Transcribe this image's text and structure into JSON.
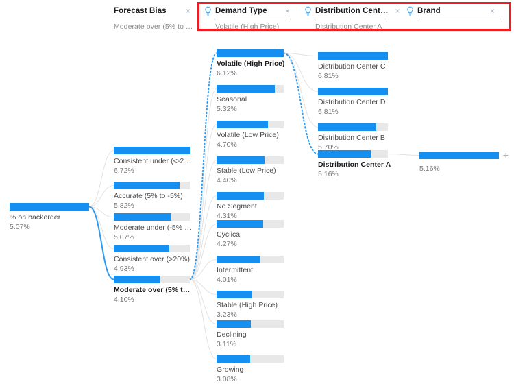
{
  "accent_color": "#1590f0",
  "track_color": "#e8e8e8",
  "highlight_box_color": "#ee1d23",
  "header": {
    "columns": [
      {
        "title": "Forecast Bias",
        "value": "Moderate over (5% to …",
        "close": "×",
        "has_bulb": false,
        "bulb_icon": "lightbulb-icon"
      },
      {
        "title": "Demand Type",
        "value": "Volatile (High Price)",
        "close": "×",
        "has_bulb": true,
        "bulb_icon": "lightbulb-icon"
      },
      {
        "title": "Distribution Cent…",
        "value": "Distribution Center A",
        "close": "×",
        "has_bulb": true,
        "bulb_icon": "lightbulb-icon"
      },
      {
        "title": "Brand",
        "value": "",
        "close": "×",
        "has_bulb": true,
        "bulb_icon": "lightbulb-icon"
      }
    ]
  },
  "expand_button": "+",
  "chart_data": {
    "type": "bar",
    "title": "% on backorder decomposition tree",
    "measure": "% on backorder",
    "levels": [
      "Root",
      "Forecast Bias",
      "Demand Type",
      "Distribution Center",
      "Brand"
    ],
    "root": {
      "label": "% on backorder",
      "value": "5.07%",
      "numeric": 5.07,
      "fill": 1.0,
      "selected": false
    },
    "columns": [
      {
        "name": "Forecast Bias",
        "nodes": [
          {
            "label": "Consistent under (<-2…",
            "value": "6.72%",
            "numeric": 6.72,
            "fill": 1.0,
            "selected": false
          },
          {
            "label": "Accurate (5% to -5%)",
            "value": "5.82%",
            "numeric": 5.82,
            "fill": 0.866,
            "selected": false
          },
          {
            "label": "Moderate under (-5% …",
            "value": "5.07%",
            "numeric": 5.07,
            "fill": 0.754,
            "selected": false
          },
          {
            "label": "Consistent over (>20%)",
            "value": "4.93%",
            "numeric": 4.93,
            "fill": 0.734,
            "selected": false
          },
          {
            "label": "Moderate over (5% t…",
            "value": "4.10%",
            "numeric": 4.1,
            "fill": 0.61,
            "selected": true
          }
        ]
      },
      {
        "name": "Demand Type",
        "nodes": [
          {
            "label": "Volatile (High Price)",
            "value": "6.12%",
            "numeric": 6.12,
            "fill": 1.0,
            "selected": true
          },
          {
            "label": "Seasonal",
            "value": "5.32%",
            "numeric": 5.32,
            "fill": 0.869,
            "selected": false
          },
          {
            "label": "Volatile (Low Price)",
            "value": "4.70%",
            "numeric": 4.7,
            "fill": 0.768,
            "selected": false
          },
          {
            "label": "Stable (Low Price)",
            "value": "4.40%",
            "numeric": 4.4,
            "fill": 0.719,
            "selected": false
          },
          {
            "label": "No Segment",
            "value": "4.31%",
            "numeric": 4.31,
            "fill": 0.704,
            "selected": false
          },
          {
            "label": "Cyclical",
            "value": "4.27%",
            "numeric": 4.27,
            "fill": 0.698,
            "selected": false
          },
          {
            "label": "Intermittent",
            "value": "4.01%",
            "numeric": 4.01,
            "fill": 0.655,
            "selected": false
          },
          {
            "label": "Stable (High Price)",
            "value": "3.23%",
            "numeric": 3.23,
            "fill": 0.528,
            "selected": false
          },
          {
            "label": "Declining",
            "value": "3.11%",
            "numeric": 3.11,
            "fill": 0.508,
            "selected": false
          },
          {
            "label": "Growing",
            "value": "3.08%",
            "numeric": 3.08,
            "fill": 0.503,
            "selected": false
          }
        ]
      },
      {
        "name": "Distribution Center",
        "nodes": [
          {
            "label": "Distribution Center C",
            "value": "6.81%",
            "numeric": 6.81,
            "fill": 1.0,
            "selected": false
          },
          {
            "label": "Distribution Center D",
            "value": "6.81%",
            "numeric": 6.81,
            "fill": 1.0,
            "selected": false
          },
          {
            "label": "Distribution Center B",
            "value": "5.70%",
            "numeric": 5.7,
            "fill": 0.837,
            "selected": false
          },
          {
            "label": "Distribution Center A",
            "value": "5.16%",
            "numeric": 5.16,
            "fill": 0.758,
            "selected": true
          }
        ]
      },
      {
        "name": "Brand",
        "nodes": [
          {
            "label": "",
            "value": "5.16%",
            "numeric": 5.16,
            "fill": 1.0,
            "selected": false
          }
        ]
      }
    ]
  }
}
